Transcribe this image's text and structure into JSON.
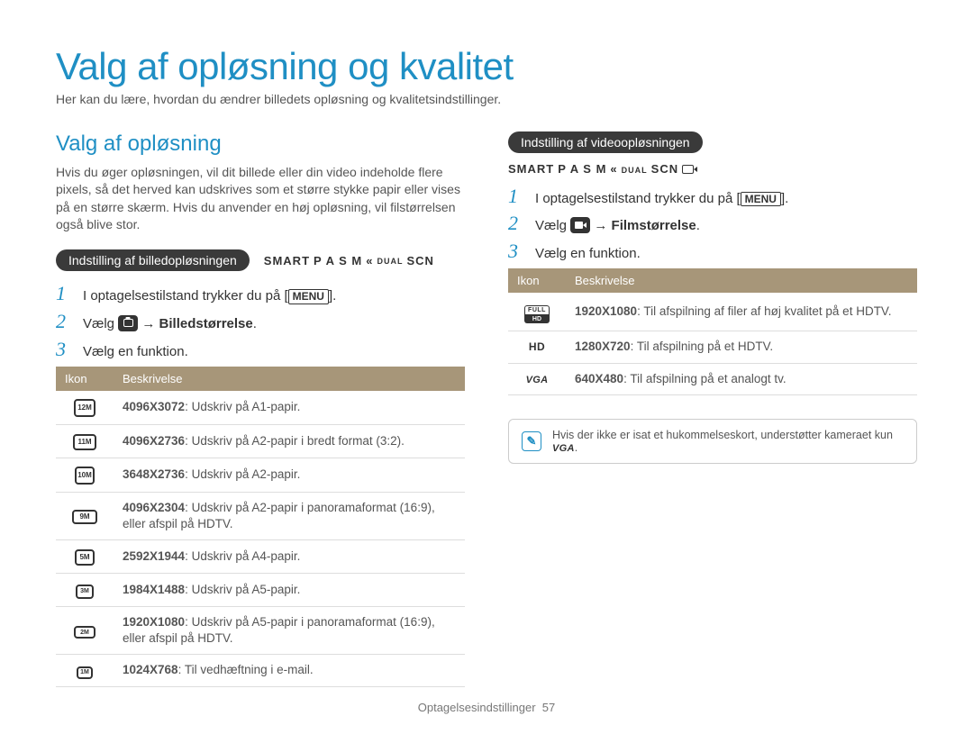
{
  "header": {
    "title": "Valg af opløsning og kvalitet",
    "intro": "Her kan du lære, hvordan du ændrer billedets opløsning og kvalitetsindstillinger."
  },
  "left": {
    "section_title": "Valg af opløsning",
    "body": "Hvis du øger opløsningen, vil dit billede eller din video indeholde flere pixels, så det herved kan udskrives som et større stykke papir eller vises på en større skærm. Hvis du anvender en høj opløsning, vil filstørrelsen også blive stor.",
    "pill": "Indstilling af billedopløsningen",
    "modes_prefix": "SMART",
    "modes_letters": "P A S M",
    "modes_dual": "DUAL",
    "modes_scn": "SCN",
    "steps": {
      "s1_pre": "I optagelsestilstand trykker du på [",
      "s1_menu": "MENU",
      "s1_post": "].",
      "s2_pre": "Vælg ",
      "s2_arrow": " → ",
      "s2_bold": "Billedstørrelse",
      "s2_post": ".",
      "s3": "Vælg en funktion."
    },
    "table": {
      "h1": "Ikon",
      "h2": "Beskrivelse",
      "rows": [
        {
          "icon": "12M",
          "cls": "ri-12m",
          "b": "4096X3072",
          "t": ": Udskriv på A1-papir."
        },
        {
          "icon": "11M",
          "cls": "ri-11m",
          "b": "4096X2736",
          "t": ": Udskriv på A2-papir i bredt format (3:2)."
        },
        {
          "icon": "10M",
          "cls": "ri-10m",
          "b": "3648X2736",
          "t": ": Udskriv på A2-papir."
        },
        {
          "icon": "9M",
          "cls": "ri-9m",
          "b": "4096X2304",
          "t": ": Udskriv på A2-papir i panoramaformat (16:9), eller afspil på HDTV."
        },
        {
          "icon": "5M",
          "cls": "ri-5m",
          "b": "2592X1944",
          "t": ": Udskriv på A4-papir."
        },
        {
          "icon": "3M",
          "cls": "ri-3m",
          "b": "1984X1488",
          "t": ": Udskriv på A5-papir."
        },
        {
          "icon": "2M",
          "cls": "ri-2m",
          "b": "1920X1080",
          "t": ": Udskriv på A5-papir i panoramaformat (16:9), eller afspil på HDTV."
        },
        {
          "icon": "1M",
          "cls": "ri-1m",
          "b": "1024X768",
          "t": ": Til vedhæftning i e-mail."
        }
      ]
    }
  },
  "right": {
    "pill": "Indstilling af videoopløsningen",
    "modes_prefix": "SMART",
    "modes_letters": "P A S M",
    "modes_dual": "DUAL",
    "modes_scn": "SCN",
    "steps": {
      "s1_pre": "I optagelsestilstand trykker du på [",
      "s1_menu": "MENU",
      "s1_post": "].",
      "s2_pre": "Vælg ",
      "s2_arrow": " → ",
      "s2_bold": "Filmstørrelse",
      "s2_post": ".",
      "s3": "Vælg en funktion."
    },
    "table": {
      "h1": "Ikon",
      "h2": "Beskrivelse",
      "rows": [
        {
          "icon": "FULLHD",
          "b": "1920X1080",
          "t": ": Til afspilning af filer af høj kvalitet på et HDTV."
        },
        {
          "icon": "HD",
          "b": "1280X720",
          "t": ": Til afspilning på et HDTV."
        },
        {
          "icon": "VGA",
          "b": "640X480",
          "t": ": Til afspilning på et analogt tv."
        }
      ]
    },
    "note_before": "Hvis der ikke er isat et hukommelseskort, understøtter kameraet kun ",
    "note_vga": "VGA",
    "note_after": "."
  },
  "footer": {
    "label": "Optagelsesindstillinger",
    "page": "57"
  }
}
